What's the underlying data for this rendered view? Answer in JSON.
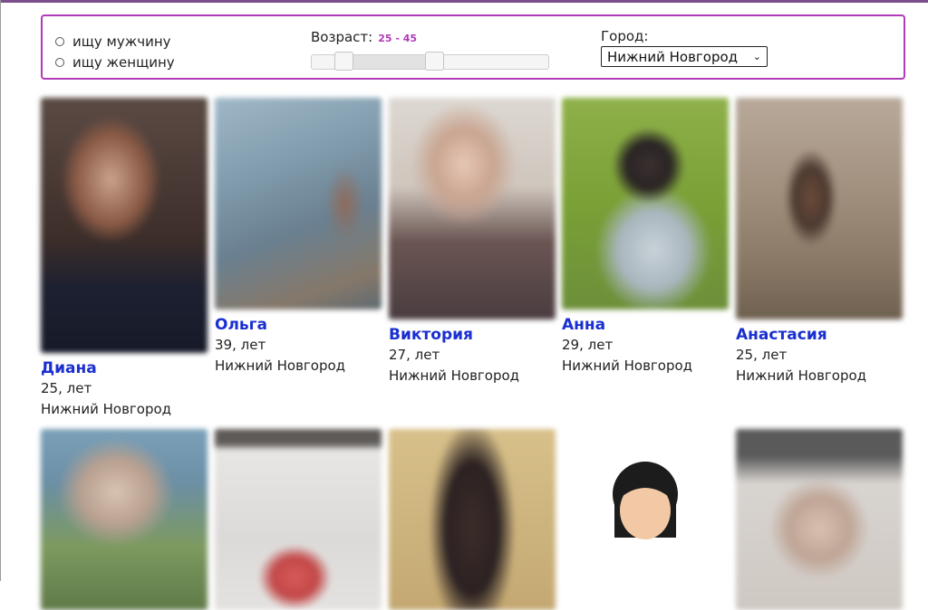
{
  "filter": {
    "gender_options": [
      "ищу мужчину",
      "ищу женщину"
    ],
    "age_label": "Возраст:",
    "age_range": "25 - 45",
    "city_label": "Город:",
    "city_value": "Нижний Новгород",
    "accent_color": "#b03ab8"
  },
  "profiles": [
    {
      "name": "Диана",
      "age": "25, лет",
      "city": "Нижний Новгород"
    },
    {
      "name": "Ольга",
      "age": "39, лет",
      "city": "Нижний Новгород"
    },
    {
      "name": "Виктория",
      "age": "27, лет",
      "city": "Нижний Новгород"
    },
    {
      "name": "Анна",
      "age": "29, лет",
      "city": "Нижний Новгород"
    },
    {
      "name": "Анастасия",
      "age": "25, лет",
      "city": "Нижний Новгород"
    }
  ],
  "link_color": "#1a2fd0"
}
